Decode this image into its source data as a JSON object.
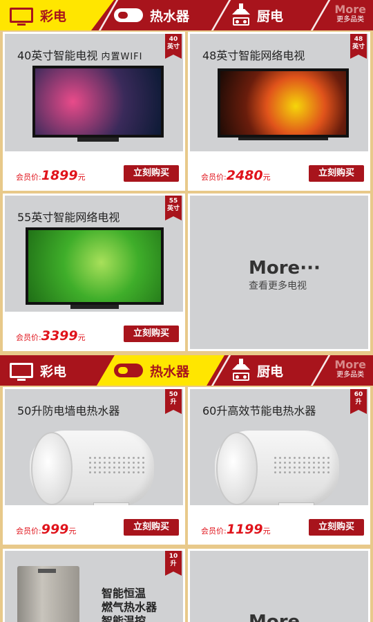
{
  "colors": {
    "accent_red": "#a8141c",
    "highlight_yellow": "#ffe600",
    "price_red": "#e0141c",
    "card_gray": "#d0d1d3",
    "page_border": "#e8c98a"
  },
  "nav_top": {
    "tabs": [
      {
        "label": "彩电",
        "icon": "tv-icon"
      },
      {
        "label": "热水器",
        "icon": "water-heater-icon"
      },
      {
        "label": "厨电",
        "icon": "range-hood-icon"
      }
    ],
    "active_index": 0,
    "more": {
      "title": "More",
      "subtitle": "更多品类"
    }
  },
  "nav_mid": {
    "tabs": [
      {
        "label": "彩电",
        "icon": "tv-icon"
      },
      {
        "label": "热水器",
        "icon": "water-heater-icon"
      },
      {
        "label": "厨电",
        "icon": "range-hood-icon"
      }
    ],
    "active_index": 1,
    "more": {
      "title": "More",
      "subtitle": "更多品类"
    }
  },
  "tv_section": {
    "products": [
      {
        "title": "40英寸智能电视",
        "title_suffix": "内置WIFI",
        "badge_num": "40",
        "badge_unit": "英寸",
        "price_label": "会员价:",
        "price": "1899",
        "price_unit": "元",
        "buy_label": "立刻购买"
      },
      {
        "title": "48英寸智能网络电视",
        "title_suffix": "",
        "badge_num": "48",
        "badge_unit": "英寸",
        "price_label": "会员价:",
        "price": "2480",
        "price_unit": "元",
        "buy_label": "立刻购买"
      },
      {
        "title": "55英寸智能网络电视",
        "title_suffix": "",
        "badge_num": "55",
        "badge_unit": "英寸",
        "price_label": "会员价:",
        "price": "3399",
        "price_unit": "元",
        "buy_label": "立刻购买"
      }
    ],
    "more": {
      "title": "More···",
      "subtitle": "查看更多电视"
    }
  },
  "heater_section": {
    "products": [
      {
        "title": "50升防电墙电热水器",
        "badge_num": "50",
        "badge_unit": "升",
        "price_label": "会员价:",
        "price": "999",
        "price_unit": "元",
        "buy_label": "立刻购买"
      },
      {
        "title": "60升高效节能电热水器",
        "badge_num": "60",
        "badge_unit": "升",
        "price_label": "会员价:",
        "price": "1199",
        "price_unit": "元",
        "buy_label": "立刻购买"
      },
      {
        "title_line1": "智能恒温",
        "title_line2": "燃气热水器",
        "title_line3": "智能温控",
        "badge_num": "10",
        "badge_unit": "升"
      }
    ],
    "more": {
      "title": "More"
    }
  }
}
